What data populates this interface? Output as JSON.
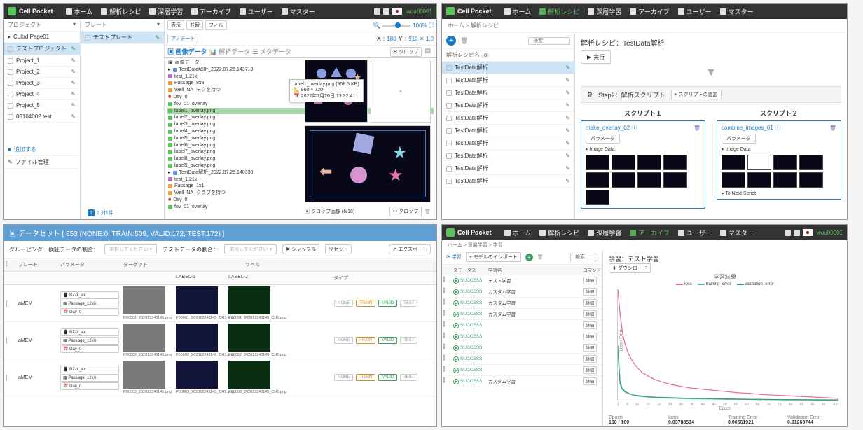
{
  "brand": "Cell Pocket",
  "user": "wou00001",
  "nav": {
    "home": "ホーム",
    "recipe": "解析レシピ",
    "deep": "深層学習",
    "archive": "アーカイブ",
    "user": "ユーザー",
    "master": "マスター"
  },
  "panelA": {
    "col1_header": "プロジェクト",
    "col1_top": "Cultrd Page01",
    "col1_sel": "テストプロジェクト",
    "projects": [
      "Project_1",
      "Project_2",
      "Project_3",
      "Project_4",
      "Project_5",
      "08104002 test"
    ],
    "add_label": "追加する",
    "file_label": "ファイル管理",
    "plate_header": "プレート",
    "plate_sel": "テストプレート",
    "plate_pager": "1  対1件",
    "toolbar": {
      "b1": "表示",
      "b2": "並替",
      "b3": "フィル",
      "b4": "アノテート"
    },
    "zoom": "100%",
    "coords": {
      "x_label": "X",
      "x": "180",
      "y_label": "Y",
      "y": "910",
      "scale": "1.0"
    },
    "tabs": {
      "t1": "画像データ",
      "t2": "解析データ",
      "t3": "メタデータ"
    },
    "tree_root": "画像データ",
    "tree": {
      "top": "TestData解析_2022.07.26.143718",
      "test": "test_1.21x",
      "tests": "TestData解析_2022.07.26.140338",
      "test2": "test_1.21x",
      "pkg": "Passage_8x8",
      "pkg2": "Passage_1x1",
      "well": "Well_NA_テクを持つ",
      "well2": "Well_NA_クラブを持つ",
      "day": "Day_0",
      "day2": "Day_0",
      "fov": "fov_01_overlay",
      "files": [
        "label1_overlay.png",
        "label2_overlay.png",
        "label3_overlay.png",
        "label4_overlay.png",
        "label5_overlay.png",
        "label6_overlay.png",
        "label7_overlay.png",
        "label8_overlay.png",
        "label9_overlay.png"
      ]
    },
    "tooltip": {
      "l1": "label1_overlay.png (958.5 KB)",
      "l2": "960 × 720",
      "l3": "2022年7月26日 13:32:41"
    },
    "crop_btn": "クロップ",
    "crop_label": "クロップ画像 (6/18)",
    "crop_action": "クロップ"
  },
  "panelB": {
    "breadcrumb": "ホーム > 解析レシピ",
    "list_header": "解析レシピ名",
    "list_count": "0",
    "search_ph": "検索",
    "items": [
      "TestData解析",
      "TestData解析",
      "TestData解析",
      "TestData解析",
      "TestData解析",
      "TestData解析",
      "TestData解析",
      "TestData解析",
      "TestData解析",
      "TestData解析"
    ],
    "title_prefix": "解析レシピ：",
    "title_value": "TestData解析",
    "run": "実行",
    "collapse": "▼",
    "step_label": "Step2：解析スクリプト",
    "add_script": "+ スクリプトの追加",
    "s1": "スクリプト１",
    "s2": "スクリプト２",
    "script1": "make_overlay_02",
    "script2": "combine_images_01",
    "param": "パラメータ",
    "imgdata": "Image Data",
    "next": "To Next Script"
  },
  "panelC": {
    "title": "データセット [ 853 (NONE:0, TRAIN:509, VALID:172, TEST:172) ]",
    "grouping": "グルーピング",
    "valid_label": "検証データの割合：",
    "test_label": "テストデータの割合：",
    "placeholder": "選択してください",
    "shuffle": "シャッフル",
    "reset": "リセット",
    "export": "エクスポート",
    "cols": {
      "plate": "プレート",
      "param": "パラメータ",
      "target": "ターゲット",
      "label": "ラベル",
      "label1": "LABEL-1",
      "label2": "LABEL-2",
      "type": "タイプ"
    },
    "plate": "aMEM",
    "params": {
      "p1": "BZ-X_4x",
      "p2": "Passage_12x6",
      "p3": "Day_0"
    },
    "caps": [
      "P00001_202012241145.png",
      "P00001_202012241145_CH1.png",
      "P00001_202012241145_CH1.png",
      "P00002_202012241145.png",
      "P00002_202012241145_CH1.png",
      "P00002_202012241145_CH1.png",
      "P00003_202012241145.png",
      "P00003_202012241145_CH1.png",
      "P00003_202012241145_CH1.png"
    ],
    "types": {
      "none": "NONE",
      "train": "TRAIN",
      "valid": "VALID",
      "test": "TEST"
    }
  },
  "panelD": {
    "breadcrumb": "ホーム > 深層学習 > 学習",
    "tab_learn": "学習",
    "import": "モデルのインポート",
    "search_ph": "検索",
    "cols": {
      "status": "ステータス",
      "name": "学習名",
      "cmd": "コマンド"
    },
    "cmd": "詳細",
    "rows": [
      {
        "s": "SUCCESS",
        "n": "テスト学習"
      },
      {
        "s": "SUCCESS",
        "n": "カスタム学習"
      },
      {
        "s": "SUCCESS",
        "n": "カスタム学習"
      },
      {
        "s": "SUCCESS",
        "n": "カスタム学習"
      },
      {
        "s": "SUCCESS",
        "n": ""
      },
      {
        "s": "SUCCESS",
        "n": ""
      },
      {
        "s": "SUCCESS",
        "n": ""
      },
      {
        "s": "SUCCESS",
        "n": ""
      },
      {
        "s": "SUCCESS",
        "n": ""
      },
      {
        "s": "SUCCESS",
        "n": "カスタム学習"
      }
    ],
    "right_title": "学習：テスト学習",
    "download": "ダウンロード",
    "chart_title": "学習結果",
    "legend": {
      "a": "loss",
      "b": "training_error",
      "c": "validation_error"
    },
    "xlabel": "Epoch",
    "ylabel": "Loss / Error",
    "metrics": {
      "m1": "Epoch",
      "m2": "Loss",
      "m3": "Training Error",
      "m4": "Validation Error",
      "v1": "100 / 100",
      "v2": "0.03788534",
      "v3": "0.00561921",
      "v4": "0.01263744"
    }
  },
  "chart_data": {
    "type": "line",
    "xlabel": "Epoch",
    "ylabel": "Loss / Error",
    "xlim": [
      1,
      100
    ],
    "ylim": [
      0,
      2.0
    ],
    "x": [
      1,
      2,
      3,
      4,
      5,
      6,
      8,
      10,
      12,
      15,
      18,
      22,
      26,
      30,
      35,
      40,
      45,
      50,
      55,
      60,
      65,
      70,
      75,
      80,
      85,
      90,
      95,
      100
    ],
    "series": [
      {
        "name": "loss",
        "color": "#e76aa3",
        "values": [
          2.0,
          1.55,
          1.25,
          1.05,
          0.92,
          0.82,
          0.68,
          0.58,
          0.5,
          0.43,
          0.37,
          0.32,
          0.28,
          0.25,
          0.22,
          0.2,
          0.18,
          0.16,
          0.14,
          0.13,
          0.11,
          0.1,
          0.09,
          0.08,
          0.07,
          0.06,
          0.05,
          0.04
        ]
      },
      {
        "name": "training_error",
        "color": "#5fb4c8",
        "values": [
          1.0,
          0.35,
          0.22,
          0.18,
          0.15,
          0.13,
          0.1,
          0.08,
          0.07,
          0.06,
          0.05,
          0.045,
          0.04,
          0.035,
          0.03,
          0.028,
          0.025,
          0.022,
          0.02,
          0.018,
          0.016,
          0.014,
          0.012,
          0.01,
          0.009,
          0.008,
          0.007,
          0.006
        ]
      },
      {
        "name": "validation_error",
        "color": "#3ba06a",
        "values": [
          0.9,
          0.3,
          0.2,
          0.16,
          0.14,
          0.12,
          0.1,
          0.09,
          0.08,
          0.07,
          0.06,
          0.055,
          0.05,
          0.045,
          0.04,
          0.037,
          0.033,
          0.03,
          0.027,
          0.024,
          0.022,
          0.02,
          0.018,
          0.017,
          0.016,
          0.015,
          0.014,
          0.013
        ]
      }
    ],
    "xticks": [
      1,
      5,
      10,
      15,
      20,
      25,
      30,
      35,
      40,
      45,
      50,
      55,
      60,
      65,
      70,
      75,
      80,
      85,
      90,
      95,
      100
    ]
  }
}
